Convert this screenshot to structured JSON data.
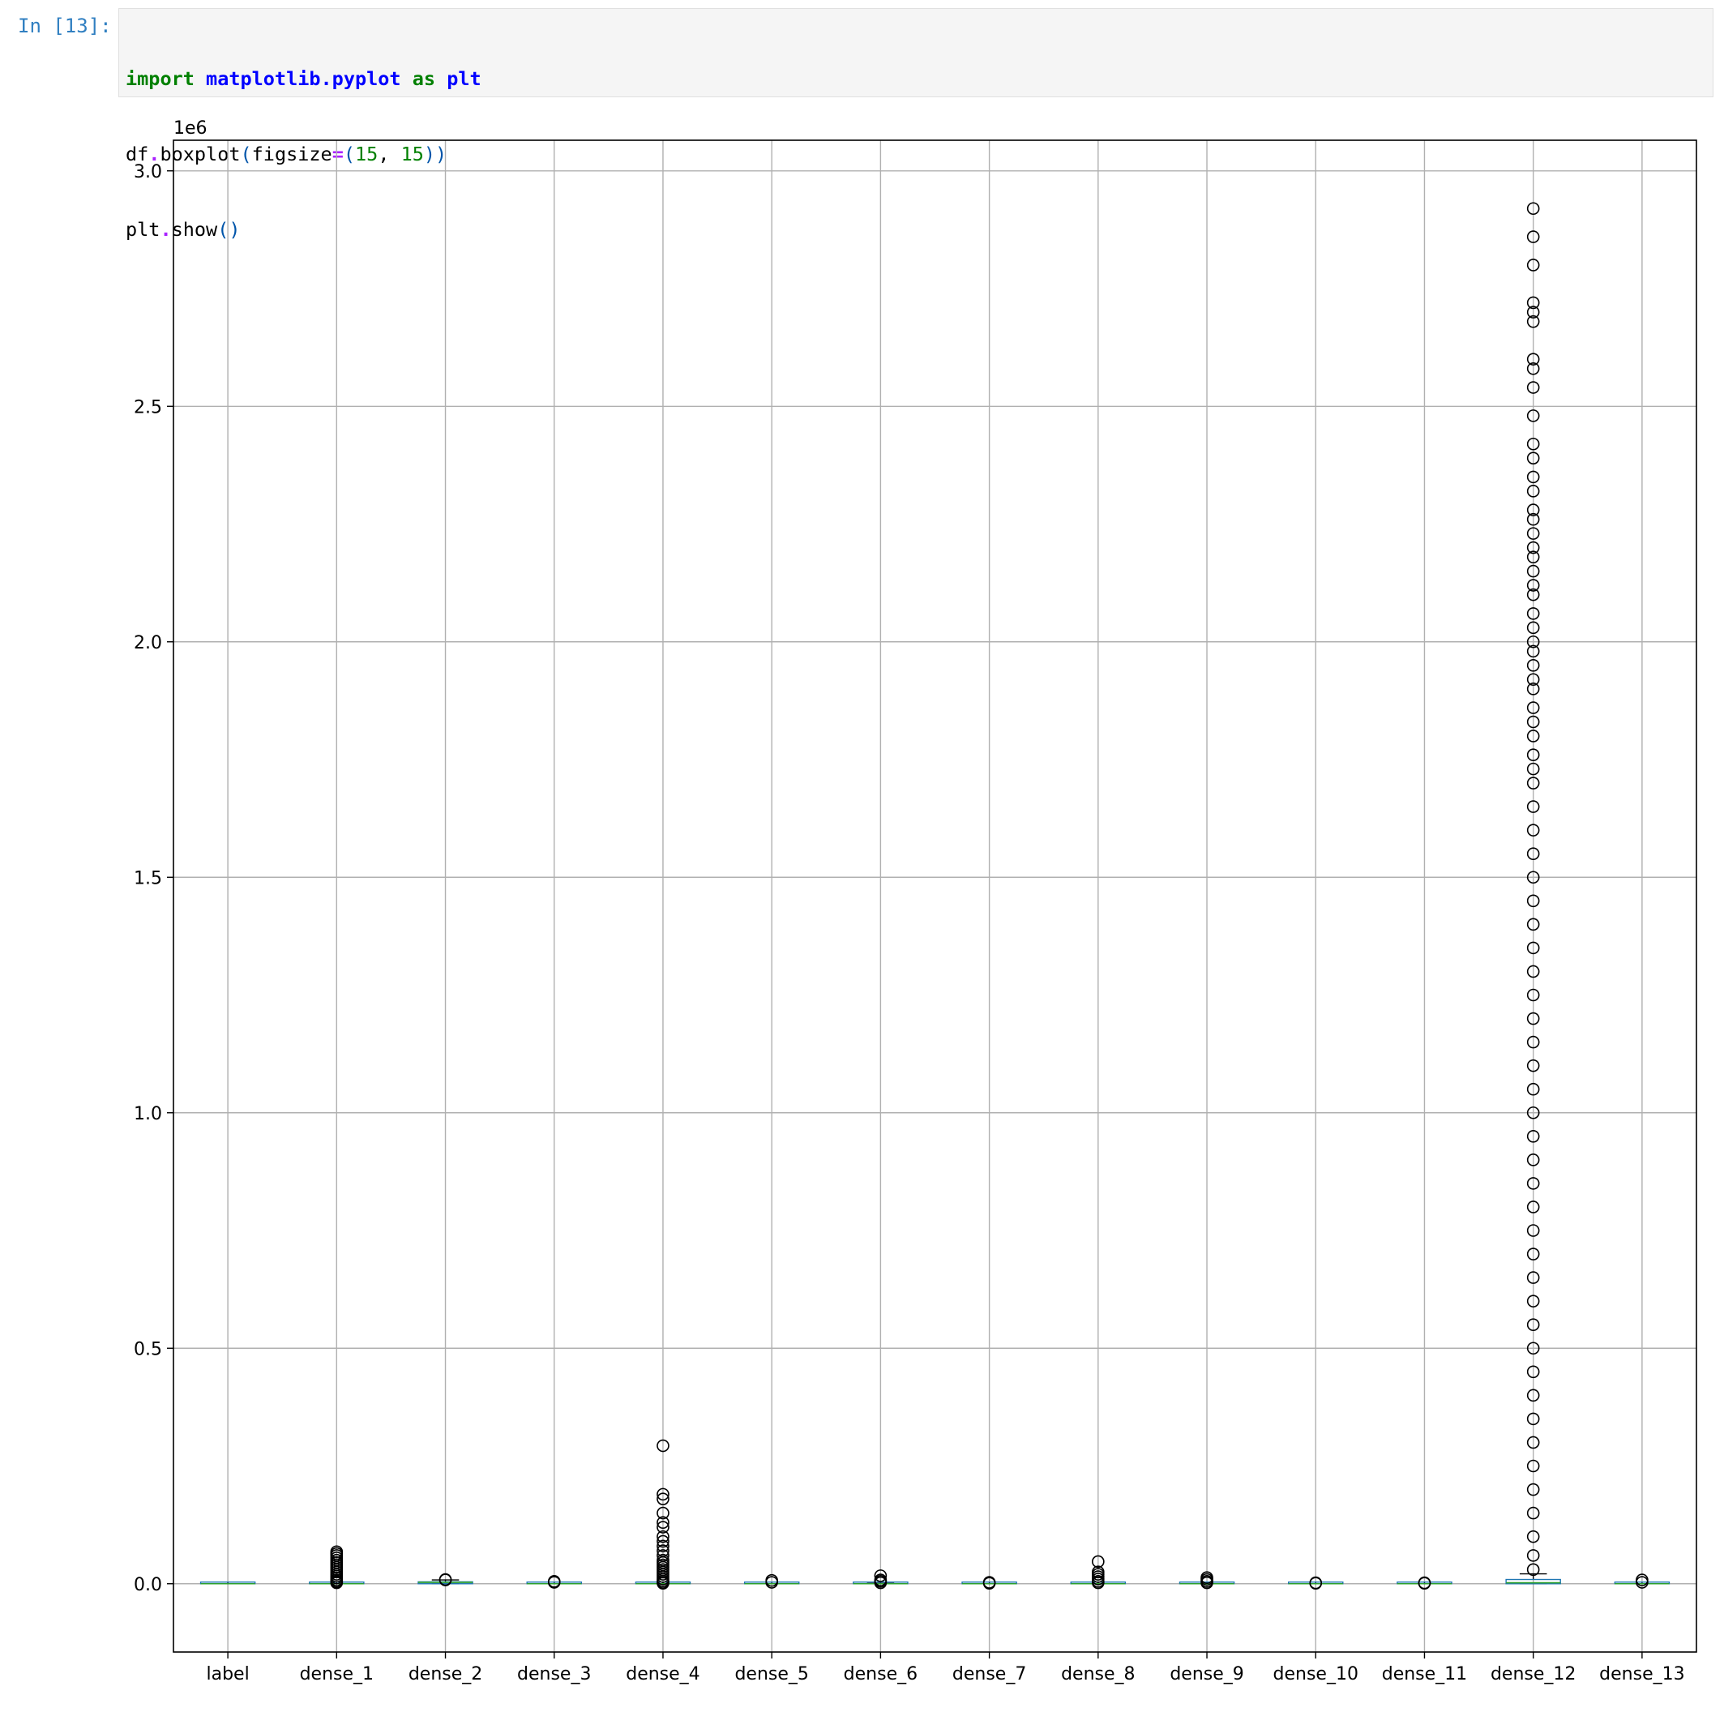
{
  "cell": {
    "prompt": "In [13]:",
    "code_line_1": {
      "kw_import": "import",
      "module": "matplotlib.pyplot",
      "kw_as": "as",
      "alias": "plt"
    },
    "code_line_2": {
      "obj": "df",
      "dot": ".",
      "method": "boxplot",
      "paren_open": "(",
      "arg_name": "figsize",
      "eq": "=",
      "tuple_open": "(",
      "num_1": "15",
      "comma": ", ",
      "num_2": "15",
      "close": "))"
    },
    "code_line_3": {
      "obj": "plt",
      "dot": ".",
      "method": "show",
      "call": "()"
    }
  },
  "chart_data": {
    "type": "boxplot",
    "categories": [
      "label",
      "dense_1",
      "dense_2",
      "dense_3",
      "dense_4",
      "dense_5",
      "dense_6",
      "dense_7",
      "dense_8",
      "dense_9",
      "dense_10",
      "dense_11",
      "dense_12",
      "dense_13"
    ],
    "offset_label": "1e6",
    "y_scale_factor": 1000000,
    "ylim": [
      -145000,
      3065000
    ],
    "yticks": [
      0,
      500000,
      1000000,
      1500000,
      2000000,
      2500000,
      3000000
    ],
    "ytick_labels": [
      "0.0",
      "0.5",
      "1.0",
      "1.5",
      "2.0",
      "2.5",
      "3.0"
    ],
    "grid": true,
    "colors": {
      "box": "#1f77b4",
      "median": "#2ca02c",
      "whisker": "#000000",
      "flier": "#000000",
      "grid": "#b0b0b0"
    },
    "boxes": [
      {
        "name": "label",
        "q1": 0,
        "median": 0,
        "q3": 0,
        "whisker_low": 0,
        "whisker_high": 1,
        "outlier_max": null
      },
      {
        "name": "dense_1",
        "q1": 0,
        "median": 3,
        "q3": 30,
        "whisker_low": 0,
        "whisker_high": 80,
        "outlier_max": 68000
      },
      {
        "name": "dense_2",
        "q1": 0,
        "median": 3000,
        "q3": 4000,
        "whisker_low": 0,
        "whisker_high": 8000,
        "outlier_max": 9000
      },
      {
        "name": "dense_3",
        "q1": 0,
        "median": 2,
        "q3": 20,
        "whisker_low": 0,
        "whisker_high": 50,
        "outlier_max": 5000
      },
      {
        "name": "dense_4",
        "q1": 0,
        "median": 2,
        "q3": 10,
        "whisker_low": 0,
        "whisker_high": 25,
        "outlier_max": 293000
      },
      {
        "name": "dense_5",
        "q1": 0,
        "median": 3,
        "q3": 30,
        "whisker_low": 0,
        "whisker_high": 80,
        "outlier_max": 7000
      },
      {
        "name": "dense_6",
        "q1": 0,
        "median": 30,
        "q3": 300,
        "whisker_low": 0,
        "whisker_high": 700,
        "outlier_max": 17000
      },
      {
        "name": "dense_7",
        "q1": 0,
        "median": 2,
        "q3": 20,
        "whisker_low": 0,
        "whisker_high": 50,
        "outlier_max": 3000
      },
      {
        "name": "dense_8",
        "q1": 0,
        "median": 5,
        "q3": 50,
        "whisker_low": 0,
        "whisker_high": 120,
        "outlier_max": 47000
      },
      {
        "name": "dense_9",
        "q1": 0,
        "median": 3,
        "q3": 30,
        "whisker_low": 0,
        "whisker_high": 80,
        "outlier_max": 13000
      },
      {
        "name": "dense_10",
        "q1": 0,
        "median": 0,
        "q3": 1,
        "whisker_low": 0,
        "whisker_high": 3,
        "outlier_max": 2000
      },
      {
        "name": "dense_11",
        "q1": 0,
        "median": 0,
        "q3": 1,
        "whisker_low": 0,
        "whisker_high": 3,
        "outlier_max": 2000
      },
      {
        "name": "dense_12",
        "q1": 0,
        "median": 2000,
        "q3": 9000,
        "whisker_low": 0,
        "whisker_high": 21000,
        "outlier_max": 2920000
      },
      {
        "name": "dense_13",
        "q1": 0,
        "median": 3,
        "q3": 30,
        "whisker_low": 0,
        "whisker_high": 80,
        "outlier_max": 8000
      }
    ],
    "outliers": {
      "dense_1": [
        2000,
        3000,
        5000,
        8000,
        12000,
        16000,
        20000,
        25000,
        30000,
        35000,
        40000,
        45000,
        50000,
        55000,
        60000,
        64000,
        68000
      ],
      "dense_2": [
        8000,
        9000
      ],
      "dense_3": [
        3000,
        5000
      ],
      "dense_4": [
        1000,
        3000,
        6000,
        10000,
        15000,
        20000,
        25000,
        30000,
        35000,
        40000,
        45000,
        50000,
        60000,
        70000,
        80000,
        90000,
        100000,
        120000,
        130000,
        150000,
        180000,
        190000,
        293000
      ],
      "dense_5": [
        3000,
        7000
      ],
      "dense_6": [
        2000,
        5000,
        8000,
        17000
      ],
      "dense_7": [
        1000,
        3000
      ],
      "dense_8": [
        2000,
        5000,
        10000,
        15000,
        20000,
        25000,
        47000
      ],
      "dense_9": [
        2000,
        5000,
        9000,
        13000
      ],
      "dense_10": [
        1000,
        2000
      ],
      "dense_11": [
        1000,
        2000
      ],
      "dense_12": [
        30000,
        60000,
        100000,
        150000,
        200000,
        250000,
        300000,
        350000,
        400000,
        450000,
        500000,
        550000,
        600000,
        650000,
        700000,
        750000,
        800000,
        850000,
        900000,
        950000,
        1000000,
        1050000,
        1100000,
        1150000,
        1200000,
        1250000,
        1300000,
        1350000,
        1400000,
        1450000,
        1500000,
        1550000,
        1600000,
        1650000,
        1700000,
        1730000,
        1760000,
        1800000,
        1830000,
        1860000,
        1900000,
        1920000,
        1950000,
        1980000,
        2000000,
        2030000,
        2060000,
        2100000,
        2120000,
        2150000,
        2180000,
        2200000,
        2230000,
        2260000,
        2280000,
        2320000,
        2350000,
        2390000,
        2420000,
        2480000,
        2540000,
        2580000,
        2600000,
        2680000,
        2700000,
        2720000,
        2800000,
        2860000,
        2920000
      ],
      "dense_13": [
        3000,
        8000
      ]
    }
  }
}
